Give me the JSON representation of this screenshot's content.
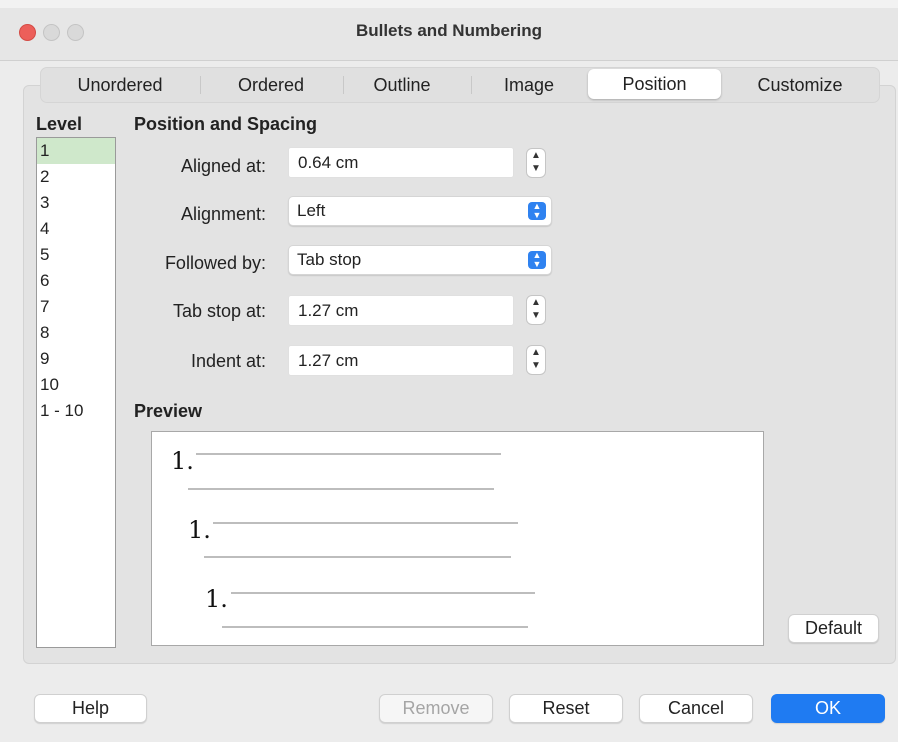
{
  "window": {
    "title": "Bullets and Numbering"
  },
  "tabs": [
    "Unordered",
    "Ordered",
    "Outline",
    "Image",
    "Position",
    "Customize"
  ],
  "selected_tab": "Position",
  "level": {
    "label": "Level",
    "items": [
      "1",
      "2",
      "3",
      "4",
      "5",
      "6",
      "7",
      "8",
      "9",
      "10",
      "1 - 10"
    ],
    "selected": "1"
  },
  "position_spacing": {
    "title": "Position and Spacing",
    "aligned_at": {
      "label": "Aligned at:",
      "value": "0.64 cm"
    },
    "alignment": {
      "label": "Alignment:",
      "value": "Left"
    },
    "followed_by": {
      "label": "Followed by:",
      "value": "Tab stop"
    },
    "tab_stop_at": {
      "label": "Tab stop at:",
      "value": "1.27 cm"
    },
    "indent_at": {
      "label": "Indent at:",
      "value": "1.27 cm"
    }
  },
  "preview": {
    "title": "Preview",
    "numbers": [
      "1.",
      "1.",
      "1."
    ]
  },
  "buttons": {
    "default": "Default",
    "help": "Help",
    "remove": "Remove",
    "reset": "Reset",
    "cancel": "Cancel",
    "ok": "OK"
  },
  "colors": {
    "accent": "#1f7bf2",
    "selection": "#cfe8cb",
    "close": "#ec5f5a"
  }
}
